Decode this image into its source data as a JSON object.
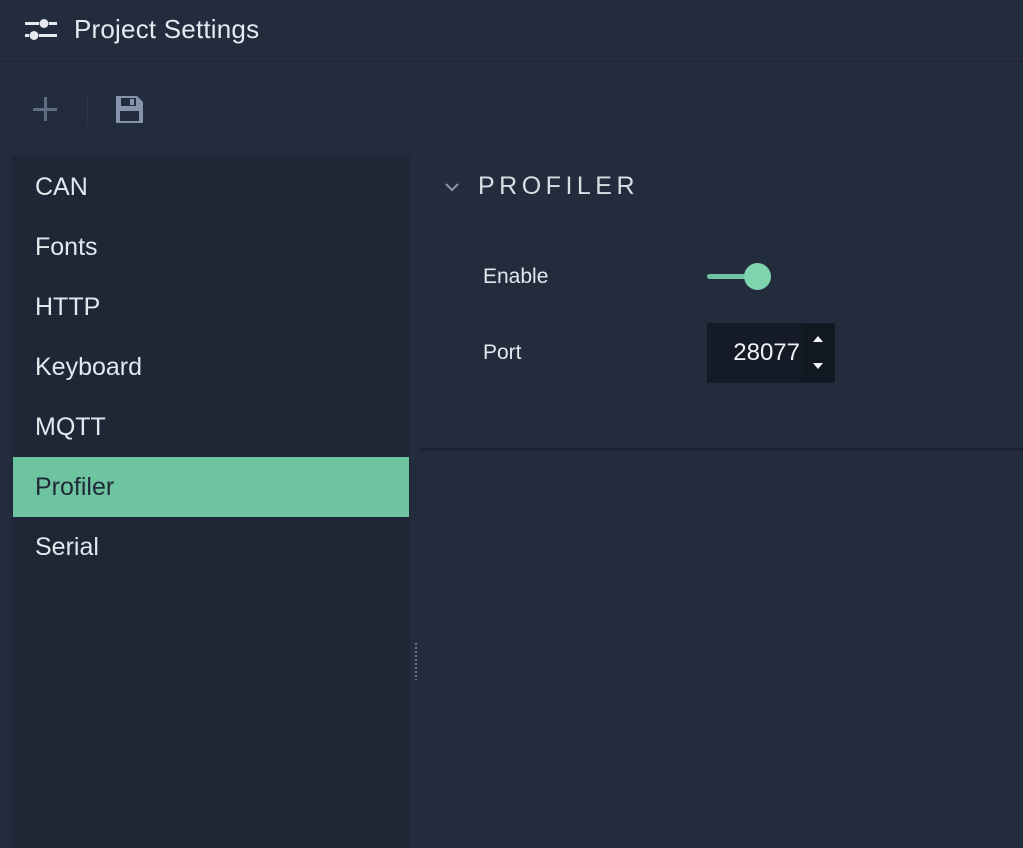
{
  "window": {
    "title": "Project Settings",
    "title_icon": "sliders-icon"
  },
  "toolbar": {
    "add_icon": "plus-icon",
    "save_icon": "save-icon"
  },
  "sidebar": {
    "items": [
      {
        "label": "CAN",
        "active": false
      },
      {
        "label": "Fonts",
        "active": false
      },
      {
        "label": "HTTP",
        "active": false
      },
      {
        "label": "Keyboard",
        "active": false
      },
      {
        "label": "MQTT",
        "active": false
      },
      {
        "label": "Profiler",
        "active": true
      },
      {
        "label": "Serial",
        "active": false
      }
    ]
  },
  "section": {
    "title": "PROFILER",
    "collapse_icon": "chevron-down-icon",
    "fields": {
      "enable": {
        "label": "Enable",
        "value": true
      },
      "port": {
        "label": "Port",
        "value": "28077"
      }
    }
  },
  "colors": {
    "background": "#222c3c",
    "sidebar": "#1e2735",
    "accent": "#6ec3a0",
    "input_bg": "#141b26"
  }
}
